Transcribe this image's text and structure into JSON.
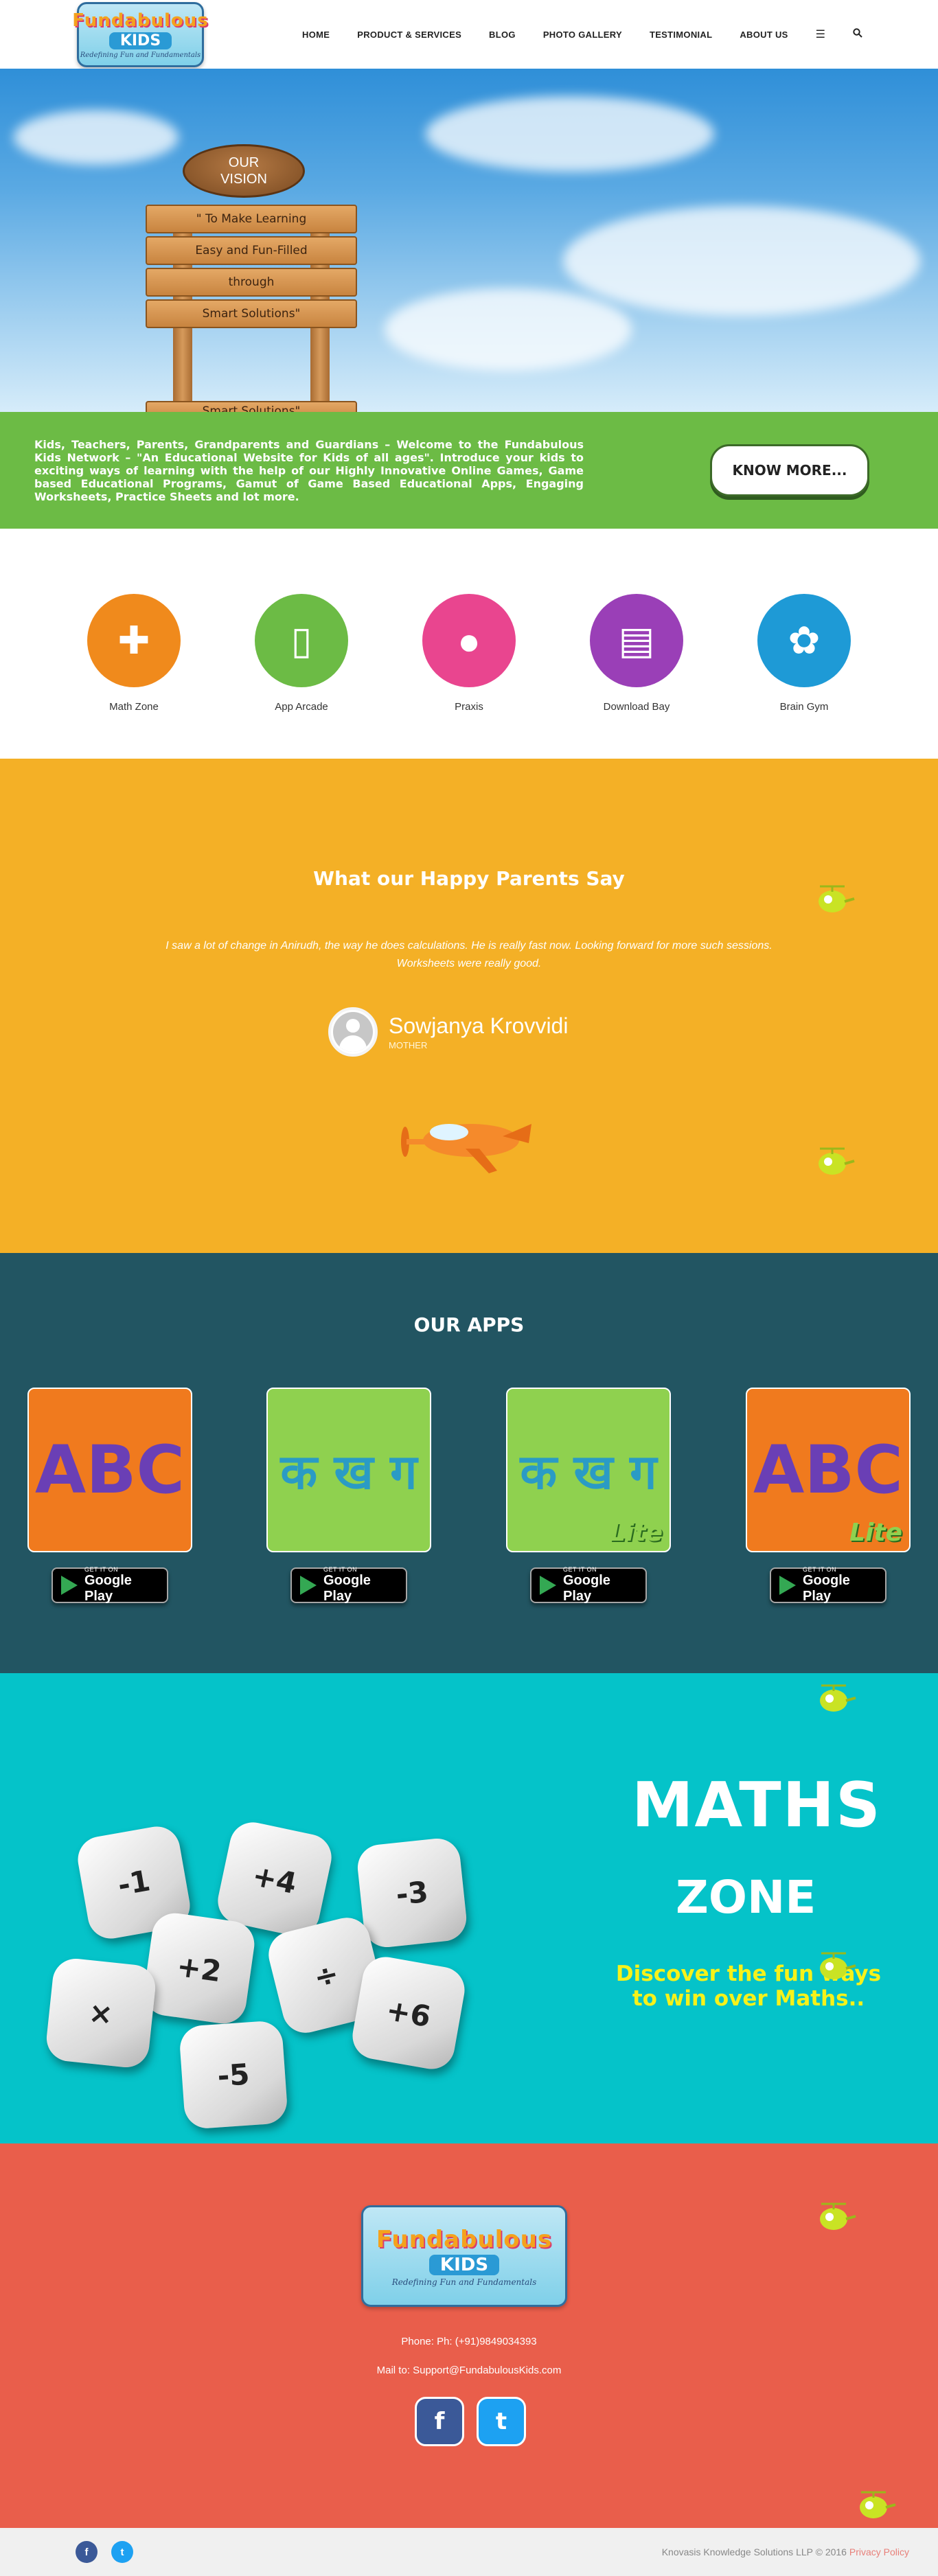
{
  "header": {
    "logo": {
      "line1": "Fundabulous",
      "line2": "KIDS",
      "tagline": "Redefining Fun and Fundamentals"
    },
    "nav": [
      "HOME",
      "PRODUCT & SERVICES",
      "BLOG",
      "PHOTO GALLERY",
      "TESTIMONIAL",
      "ABOUT US"
    ],
    "menu_icon": "hamburger-icon",
    "search_icon": "search-icon"
  },
  "hero": {
    "sign_title_1": "OUR",
    "sign_title_2": "VISION",
    "planks": [
      "\" To Make Learning",
      "Easy and Fun-Filled",
      "through",
      "Smart Solutions\"",
      "Smart Solutions\""
    ]
  },
  "welcome": {
    "text": "Kids, Teachers, Parents, Grandparents and Guardians – Welcome to the Fundabulous Kids Network – \"An Educational Website for Kids of all ages\". Introduce your kids to exciting ways of learning with the help of our Highly Innovative Online Games, Game based Educational Programs, Gamut of Game Based Educational Apps, Engaging Worksheets, Practice Sheets and lot more.",
    "button": "KNOW MORE..."
  },
  "categories": [
    {
      "label": "Math Zone",
      "icon": "puzzle-icon",
      "color": "#f08a1c"
    },
    {
      "label": "App Arcade",
      "icon": "tablet-icon",
      "color": "#6cbb45"
    },
    {
      "label": "Praxis",
      "icon": "parrot-icon",
      "color": "#e9458f"
    },
    {
      "label": "Download Bay",
      "icon": "notebook-icon",
      "color": "#9a3fb7"
    },
    {
      "label": "Brain Gym",
      "icon": "brain-icon",
      "color": "#1e9ad6"
    }
  ],
  "testimonial": {
    "heading": "What our Happy Parents Say",
    "quote": "I saw a lot of change in Anirudh, the way he does calculations. He is really fast now. Looking forward for more such sessions. Worksheets were really good.",
    "author_name": "Sowjanya Krovvidi",
    "author_role": "MOTHER"
  },
  "apps": {
    "heading": "OUR APPS",
    "items": [
      {
        "glyph": "ABC",
        "lite": "",
        "bg": "#f07a1e",
        "fg": "#6a3fb5"
      },
      {
        "glyph": "क ख ग",
        "lite": "",
        "bg": "#8fd14f",
        "fg": "#2a9bc5"
      },
      {
        "glyph": "क ख ग",
        "lite": "Lite",
        "bg": "#8fd14f",
        "fg": "#2a9bc5"
      },
      {
        "glyph": "ABC",
        "lite": "Lite",
        "bg": "#f07a1e",
        "fg": "#6a3fb5"
      }
    ],
    "store_small": "GET IT ON",
    "store_big": "Google Play"
  },
  "maths": {
    "title": "MATHS",
    "zone": "ZONE",
    "tagline_1": "Discover the fun ways",
    "tagline_2": "to win over Maths..",
    "dice": [
      "-1",
      "+4",
      "-3",
      "+2",
      "÷",
      "×",
      "+6",
      "-5",
      "-3",
      "×"
    ]
  },
  "footer": {
    "logo_line1": "Fundabulous",
    "logo_line2": "KIDS",
    "logo_tagline": "Redefining Fun and Fundamentals",
    "phone": "Phone: Ph: (+91)9849034393",
    "mail": "Mail to: Support@FundabulousKids.com",
    "facebook": "f",
    "twitter": "t"
  },
  "bottom": {
    "copyright": "Knovasis Knowledge Solutions LLP © 2016",
    "privacy": "Privacy Policy",
    "facebook": "f",
    "twitter": "t"
  }
}
